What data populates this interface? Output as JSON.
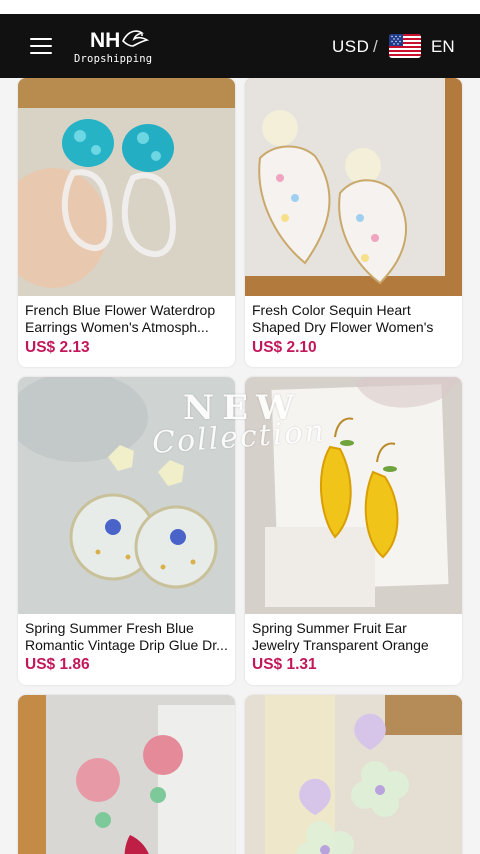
{
  "header": {
    "logo_text": "NH",
    "logo_subtitle": "Dropshipping",
    "currency": "USD",
    "divider": "/",
    "language": "EN",
    "menu_icon": "hamburger-menu-icon",
    "flag_icon": "us-flag-icon"
  },
  "overlay": {
    "new": "NEW",
    "collection": "Collection"
  },
  "products": [
    {
      "title": "French Blue Flower Waterdrop Earrings Women's Atmosph...",
      "price": "US$ 2.13"
    },
    {
      "title": "Fresh Color Sequin Heart Shaped Dry Flower Women's Sw...",
      "price": "US$ 2.10"
    },
    {
      "title": "Spring Summer Fresh Blue Romantic Vintage Drip Glue Dr...",
      "price": "US$ 1.86"
    },
    {
      "title": "Spring Summer Fruit Ear Jewelry Transparent Orange Slice...",
      "price": "US$ 1.31"
    },
    {
      "title": "",
      "price": ""
    },
    {
      "title": "",
      "price": ""
    }
  ],
  "colors": {
    "header_bg": "#111111",
    "price": "#c2185b",
    "page_bg": "#f4f4f4"
  }
}
